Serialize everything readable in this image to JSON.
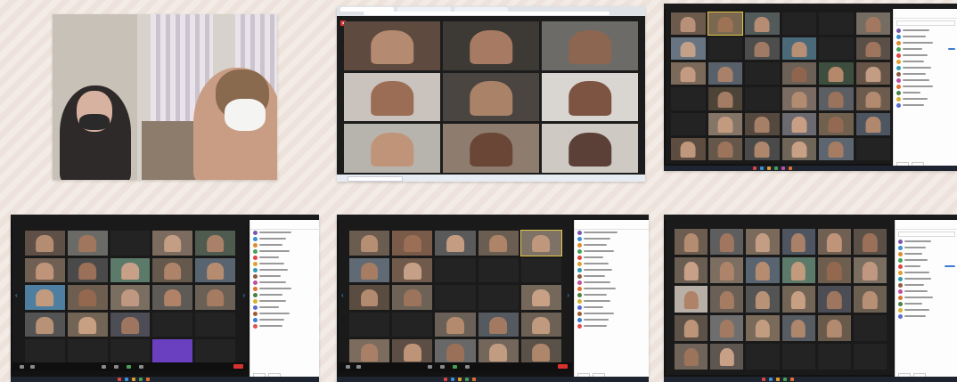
{
  "colors": {
    "page_bg": "#f1e8e1",
    "zoom_stage": "#1a1a1a",
    "zoom_end_button": "#d7322f",
    "active_speaker_border": "#e2c84a",
    "recording_badge": "#d9353a"
  },
  "screenshots": [
    {
      "kind": "photo",
      "description_icon": "camera-photo-icon"
    },
    {
      "kind": "browser-zoom-gallery",
      "tiles": 9
    },
    {
      "kind": "zoom-gallery-with-participants",
      "tiles": 36
    },
    {
      "kind": "zoom-gallery-with-participants",
      "tiles": 25
    },
    {
      "kind": "zoom-gallery-with-participants",
      "tiles": 25
    },
    {
      "kind": "zoom-gallery-with-participants",
      "tiles": 30
    }
  ]
}
